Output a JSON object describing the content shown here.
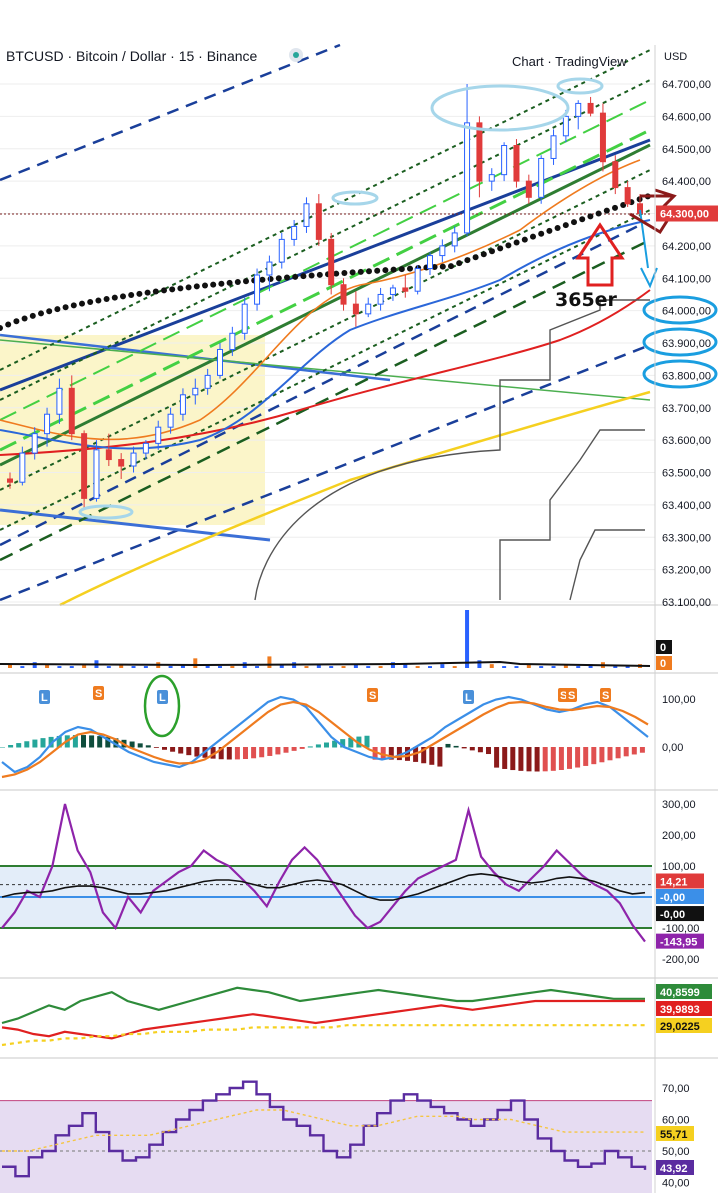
{
  "header": {
    "symbol": "BTCUSD · Bitcoin / Dollar · 15 · Binance",
    "watermark": "Chart · TradingView",
    "currency": "USD"
  },
  "annotation": {
    "text": "365er"
  },
  "colors": {
    "up": "#2962ff",
    "down": "#e03b3b",
    "grid": "#eeeeee",
    "background": "#ffffff",
    "ema_fast": "#ef7b1f",
    "ema_mid": "#2b67d9",
    "ema_slow": "#e02020",
    "ema_long": "#f5d020",
    "channel": "#1a3f9a",
    "sar": "#111111",
    "highlight_zone": "#faf3c0"
  },
  "chart_data": [
    {
      "type": "candlestick",
      "panel": "price",
      "title": "BTCUSD · Bitcoin / Dollar · 15 · Binance",
      "y_ticks": [
        "64.700,00",
        "64.600,00",
        "64.500,00",
        "64.400,00",
        "64.300,00",
        "64.200,00",
        "64.100,00",
        "64.000,00",
        "63.900,00",
        "63.800,00",
        "63.700,00",
        "63.600,00",
        "63.500,00",
        "63.400,00",
        "63.300,00",
        "63.200,00",
        "63.100,00"
      ],
      "ylim": [
        63100,
        64750
      ],
      "last_price": {
        "value": 64300,
        "label": "64.300,00"
      },
      "candles": [
        [
          63480,
          63500,
          63450,
          63470
        ],
        [
          63470,
          63580,
          63460,
          63560
        ],
        [
          63560,
          63640,
          63540,
          63620
        ],
        [
          63620,
          63700,
          63580,
          63680
        ],
        [
          63680,
          63790,
          63650,
          63760
        ],
        [
          63760,
          63800,
          63600,
          63620
        ],
        [
          63620,
          63630,
          63390,
          63420
        ],
        [
          63420,
          63600,
          63410,
          63570
        ],
        [
          63570,
          63620,
          63520,
          63540
        ],
        [
          63540,
          63560,
          63480,
          63520
        ],
        [
          63520,
          63580,
          63500,
          63560
        ],
        [
          63560,
          63600,
          63540,
          63590
        ],
        [
          63590,
          63660,
          63570,
          63640
        ],
        [
          63640,
          63700,
          63620,
          63680
        ],
        [
          63680,
          63760,
          63660,
          63740
        ],
        [
          63740,
          63790,
          63710,
          63760
        ],
        [
          63760,
          63820,
          63740,
          63800
        ],
        [
          63800,
          63900,
          63790,
          63880
        ],
        [
          63880,
          63950,
          63860,
          63930
        ],
        [
          63930,
          64040,
          63910,
          64020
        ],
        [
          64020,
          64130,
          64000,
          64110
        ],
        [
          64110,
          64170,
          64060,
          64150
        ],
        [
          64150,
          64240,
          64130,
          64220
        ],
        [
          64220,
          64280,
          64200,
          64260
        ],
        [
          64260,
          64350,
          64240,
          64330
        ],
        [
          64330,
          64360,
          64200,
          64220
        ],
        [
          64220,
          64240,
          64050,
          64080
        ],
        [
          64080,
          64100,
          64000,
          64020
        ],
        [
          64020,
          64060,
          63950,
          63990
        ],
        [
          63990,
          64040,
          63980,
          64020
        ],
        [
          64020,
          64070,
          64000,
          64050
        ],
        [
          64050,
          64080,
          64030,
          64070
        ],
        [
          64070,
          64110,
          64040,
          64060
        ],
        [
          64060,
          64140,
          64050,
          64130
        ],
        [
          64130,
          64180,
          64110,
          64170
        ],
        [
          64170,
          64220,
          64150,
          64200
        ],
        [
          64200,
          64260,
          64180,
          64240
        ],
        [
          64240,
          64700,
          64230,
          64580
        ],
        [
          64580,
          64600,
          64350,
          64400
        ],
        [
          64400,
          64440,
          64370,
          64420
        ],
        [
          64420,
          64520,
          64400,
          64510
        ],
        [
          64510,
          64530,
          64380,
          64400
        ],
        [
          64400,
          64420,
          64330,
          64350
        ],
        [
          64350,
          64480,
          64330,
          64470
        ],
        [
          64470,
          64560,
          64450,
          64540
        ],
        [
          64540,
          64620,
          64520,
          64600
        ],
        [
          64600,
          64650,
          64560,
          64640
        ],
        [
          64640,
          64660,
          64600,
          64610
        ],
        [
          64610,
          64640,
          64430,
          64460
        ],
        [
          64460,
          64480,
          64360,
          64380
        ],
        [
          64380,
          64400,
          64320,
          64330
        ],
        [
          64330,
          64360,
          64290,
          64300
        ]
      ]
    },
    {
      "type": "bar",
      "panel": "volume",
      "labels": [
        "0",
        "0"
      ],
      "values": [
        2,
        1,
        3,
        2,
        1,
        1,
        2,
        4,
        1,
        2,
        1,
        1,
        3,
        1,
        2,
        5,
        2,
        1,
        1,
        3,
        1,
        6,
        2,
        3,
        1,
        2,
        1,
        1,
        2,
        1,
        1,
        3,
        2,
        1,
        1,
        2,
        1,
        30,
        4,
        2,
        1,
        1,
        2,
        1,
        1,
        2,
        1,
        2,
        3,
        1,
        1,
        2
      ]
    },
    {
      "type": "line",
      "panel": "oscillator",
      "y_ticks": [
        "100,00",
        "0,00"
      ],
      "markers": [
        "L",
        "S",
        "L",
        "S",
        "L",
        "S",
        "S",
        "S"
      ],
      "series": [
        {
          "values": [
            -30,
            -50,
            -40,
            -20,
            10,
            30,
            40,
            35,
            20,
            5,
            -10,
            -20,
            -30,
            -35,
            -40,
            -30,
            -10,
            10,
            30,
            50,
            70,
            90,
            100,
            95,
            80,
            50,
            20,
            0,
            -10,
            -20,
            -25,
            -20,
            -10,
            5,
            20,
            40,
            55,
            70,
            85,
            95,
            100,
            95,
            85,
            75,
            70,
            75,
            85,
            90,
            80,
            60,
            40,
            20
          ]
        },
        {
          "values": [
            -60,
            -55,
            -45,
            -30,
            -10,
            10,
            25,
            30,
            25,
            15,
            0,
            -10,
            -20,
            -28,
            -33,
            -32,
            -25,
            -10,
            10,
            30,
            50,
            70,
            85,
            90,
            85,
            70,
            50,
            30,
            10,
            -5,
            -15,
            -20,
            -18,
            -10,
            5,
            20,
            35,
            50,
            65,
            78,
            88,
            90,
            87,
            80,
            75,
            74,
            78,
            82,
            80,
            72,
            60,
            45
          ]
        }
      ]
    },
    {
      "type": "line",
      "panel": "cci",
      "y_ticks": [
        "300,00",
        "200,00",
        "100,00",
        "0,00",
        "-100,00",
        "-200,00"
      ],
      "labels": [
        "14,21",
        "-0,00",
        "-0,00",
        "-143,95"
      ],
      "series": [
        {
          "values": [
            -100,
            -50,
            20,
            0,
            100,
            300,
            150,
            80,
            -50,
            -100,
            0,
            -50,
            20,
            50,
            80,
            100,
            150,
            120,
            100,
            60,
            20,
            -30,
            50,
            120,
            160,
            120,
            60,
            0,
            -60,
            -100,
            -80,
            -30,
            20,
            60,
            80,
            100,
            120,
            280,
            130,
            80,
            40,
            20,
            60,
            100,
            150,
            110,
            70,
            40,
            20,
            -20,
            -90,
            -144
          ]
        },
        {
          "values": [
            0,
            10,
            15,
            15,
            20,
            30,
            35,
            35,
            30,
            20,
            10,
            10,
            15,
            20,
            30,
            40,
            50,
            55,
            55,
            50,
            40,
            30,
            30,
            40,
            50,
            55,
            50,
            40,
            20,
            0,
            -10,
            -10,
            0,
            10,
            25,
            40,
            55,
            70,
            75,
            70,
            60,
            50,
            45,
            50,
            60,
            65,
            60,
            50,
            35,
            20,
            10,
            14
          ]
        }
      ]
    },
    {
      "type": "line",
      "panel": "dmi",
      "labels": [
        "40,8599",
        "39,9893",
        "29,0225"
      ],
      "series": [
        {
          "values": [
            30,
            32,
            35,
            38,
            36,
            40,
            42,
            44,
            40,
            38,
            36,
            38,
            40,
            42,
            44,
            46,
            45,
            44,
            42,
            40,
            41,
            42,
            43,
            44,
            45,
            44,
            43,
            42,
            41,
            40,
            40,
            41,
            42,
            43,
            44,
            45,
            44,
            43,
            42,
            41,
            41,
            41
          ]
        },
        {
          "values": [
            28,
            27,
            25,
            24,
            26,
            25,
            24,
            23,
            25,
            27,
            28,
            29,
            30,
            31,
            32,
            33,
            34,
            33,
            32,
            31,
            30,
            31,
            32,
            33,
            34,
            35,
            36,
            37,
            38,
            37,
            36,
            37,
            38,
            39,
            40,
            40,
            40,
            40,
            40,
            40,
            40,
            40
          ]
        },
        {
          "values": [
            20,
            21,
            22,
            22,
            23,
            23,
            24,
            24,
            25,
            25,
            26,
            26,
            26,
            27,
            27,
            27,
            28,
            28,
            28,
            28,
            28,
            28,
            29,
            29,
            29,
            29,
            29,
            29,
            29,
            29,
            29,
            29,
            29,
            29,
            29,
            29,
            29,
            29,
            29,
            29,
            29,
            29
          ]
        }
      ]
    },
    {
      "type": "line",
      "panel": "rsi",
      "y_ticks": [
        "70,00",
        "60,00",
        "50,00",
        "40,00"
      ],
      "labels": [
        "55,71",
        "43,92"
      ],
      "series": [
        {
          "values": [
            45,
            42,
            48,
            50,
            55,
            58,
            62,
            56,
            50,
            47,
            48,
            52,
            56,
            60,
            63,
            66,
            68,
            70,
            72,
            68,
            64,
            60,
            58,
            55,
            50,
            48,
            52,
            58,
            62,
            66,
            68,
            66,
            64,
            62,
            60,
            58,
            60,
            63,
            66,
            60,
            54,
            50,
            47,
            45,
            46,
            50,
            48,
            45,
            44
          ]
        },
        {
          "values": [
            50,
            50,
            50,
            51,
            52,
            53,
            54,
            55,
            55,
            55,
            55,
            55,
            56,
            57,
            58,
            59,
            60,
            61,
            62,
            63,
            63,
            63,
            62,
            61,
            60,
            59,
            58,
            58,
            58,
            59,
            60,
            61,
            61,
            61,
            61,
            60,
            60,
            60,
            60,
            59,
            58,
            57,
            56,
            56,
            56,
            56,
            56,
            56,
            56
          ]
        }
      ]
    }
  ]
}
